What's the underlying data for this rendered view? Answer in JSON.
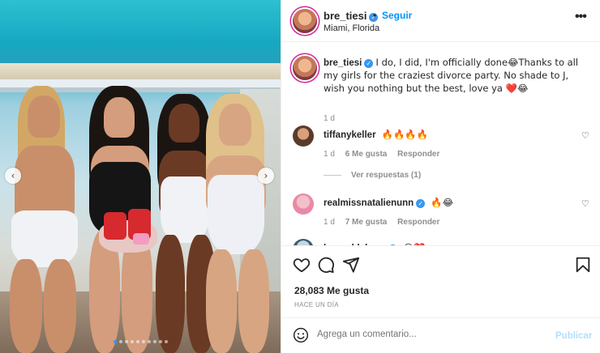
{
  "post": {
    "username": "bre_tiesi",
    "follow_label": "Seguir",
    "separator": "•",
    "location": "Miami, Florida",
    "more_label": "•••"
  },
  "caption": {
    "username": "bre_tiesi",
    "text": "I do, I did, I'm officially done😂Thanks to all my girls for the craziest divorce party. No shade to J, wish you nothing but the best, love ya ❤️😂",
    "time": "1 d"
  },
  "comments": [
    {
      "username": "tiffanykeller",
      "text": "🔥🔥🔥🔥",
      "time": "1 d",
      "likes": "6 Me gusta",
      "reply": "Responder"
    },
    {
      "username": "realmissnatalienunn",
      "text": "🔥😂",
      "time": "1 d",
      "likes": "7 Me gusta",
      "reply": "Responder"
    },
    {
      "username": "laurenblakess",
      "text": "😂❤️"
    }
  ],
  "view_replies": "Ver respuestas (1)",
  "actions": {
    "likes": "28,083 Me gusta",
    "ago": "HACE UN DÍA"
  },
  "add_comment": {
    "placeholder": "Agrega un comentario...",
    "post_label": "Publicar"
  },
  "carousel": {
    "prev": "‹",
    "next": "›",
    "dot_count": 10,
    "active_dot": 0
  },
  "colors": {
    "accent": "#0095f6",
    "verified": "#3897f0",
    "muted": "#8e8e8e",
    "text": "#262626"
  }
}
